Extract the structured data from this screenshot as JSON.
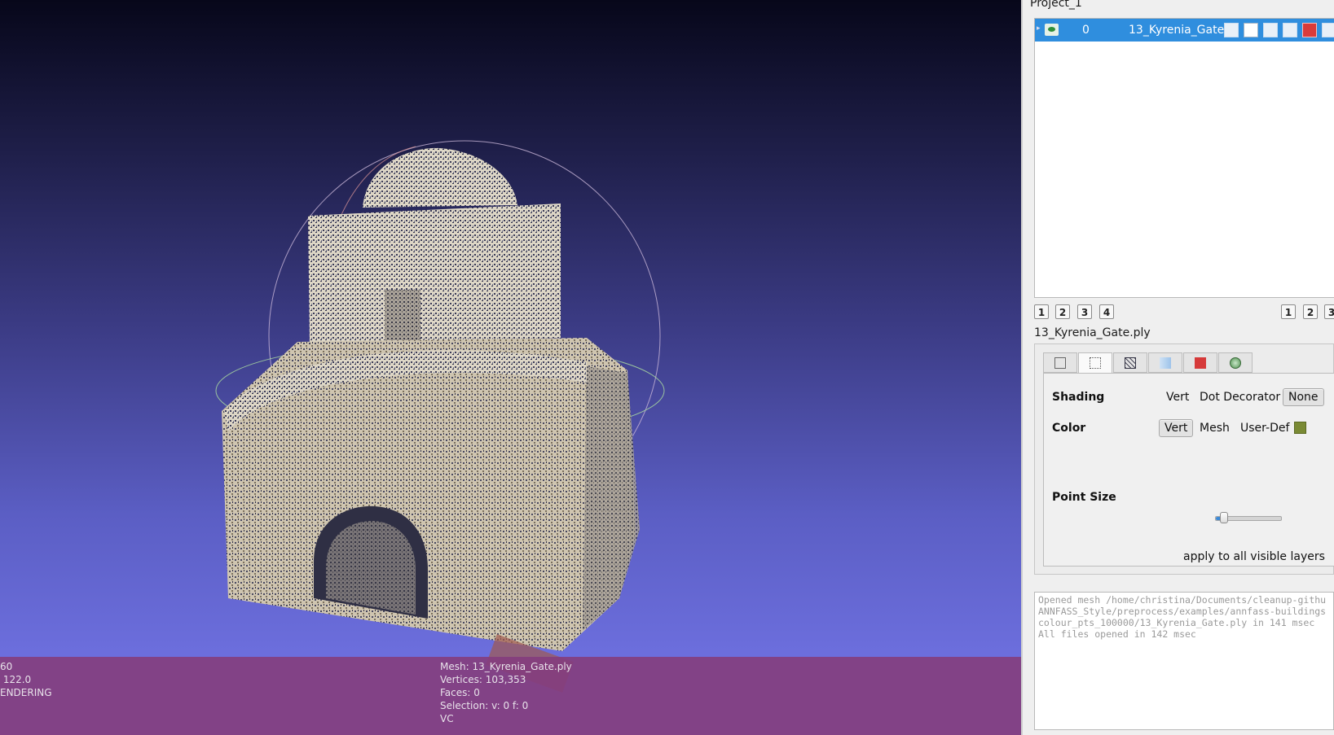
{
  "viewport": {
    "info_left": [
      "60",
      " 122.0",
      "ENDERING"
    ],
    "info_mid": [
      "Mesh: 13_Kyrenia_Gate.ply",
      "Vertices: 103,353",
      "Faces: 0",
      "Selection: v: 0 f: 0",
      "VC"
    ],
    "background_top": "#07071a",
    "background_bottom": "#6d6fde",
    "info_bar_color": "#843e7e"
  },
  "project": {
    "title": "Project_1"
  },
  "layers": [
    {
      "index": "0",
      "name": "13_Kyrenia_Gate",
      "visible_icon": "eye-icon",
      "selected": true
    }
  ],
  "layer_pages_left": [
    "1",
    "2",
    "3",
    "4"
  ],
  "layer_pages_right": [
    "1",
    "2",
    "3"
  ],
  "decorator": {
    "mesh_file": "13_Kyrenia_Gate.ply",
    "tabs": [
      "box-icon",
      "points-icon",
      "wireframe-icon",
      "flat-icon",
      "texture-icon",
      "sphere-icon"
    ],
    "active_tab": 1,
    "shading_label": "Shading",
    "shading_options": [
      "Vert",
      "Dot Decorator",
      "None"
    ],
    "shading_selected": "None",
    "color_label": "Color",
    "color_options": [
      "Vert",
      "Mesh",
      "User-Def"
    ],
    "color_selected": "Vert",
    "user_def_color": "#7a8a34",
    "point_size_label": "Point Size",
    "point_size_fraction": 0.12,
    "apply_all": "apply to all visible layers"
  },
  "log": [
    "Opened mesh /home/christina/Documents/cleanup-githu",
    "ANNFASS_Style/preprocess/examples/annfass-buildings",
    "colour_pts_100000/13_Kyrenia_Gate.ply in 141 msec",
    "All files opened in 142 msec"
  ]
}
